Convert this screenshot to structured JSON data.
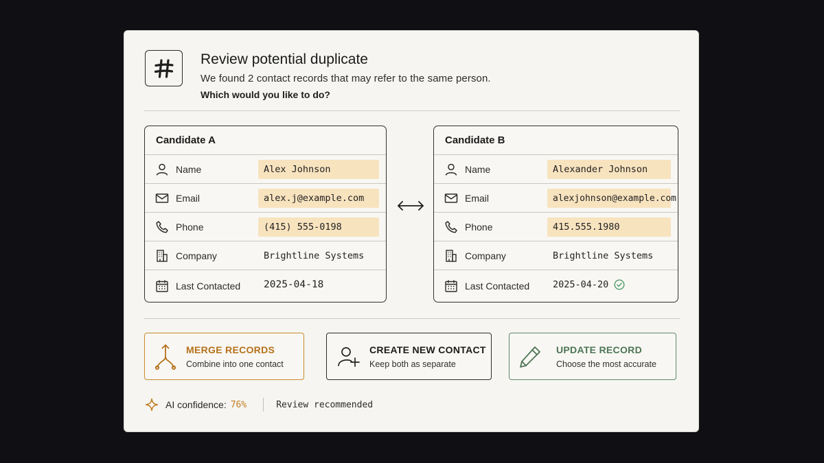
{
  "dialog": {
    "logo_icon": "hash-icon",
    "title": "Review potential duplicate",
    "subtitle": "We found 2 contact records that may refer to the same person.",
    "question": "Which would you like to do?"
  },
  "candidates": [
    {
      "title": "Candidate A",
      "fields": [
        {
          "icon": "user-icon",
          "label": "Name",
          "value": "Alex Johnson",
          "highlighted": true
        },
        {
          "icon": "mail-icon",
          "label": "Email",
          "value": "alex.j@example.com",
          "highlighted": true
        },
        {
          "icon": "phone-icon",
          "label": "Phone",
          "value": "(415) 555-0198",
          "highlighted": true
        },
        {
          "icon": "building-icon",
          "label": "Company",
          "value": "Brightline Systems",
          "highlighted": false
        },
        {
          "icon": "calendar-icon",
          "label": "Last Contacted",
          "value": "2025-04-18",
          "highlighted": false
        }
      ]
    },
    {
      "title": "Candidate B",
      "fields": [
        {
          "icon": "user-icon",
          "label": "Name",
          "value": "Alexander Johnson",
          "highlighted": true
        },
        {
          "icon": "mail-icon",
          "label": "Email",
          "value": "alexjohnson@example.com",
          "highlighted": true
        },
        {
          "icon": "phone-icon",
          "label": "Phone",
          "value": "415.555.1980",
          "highlighted": true
        },
        {
          "icon": "building-icon",
          "label": "Company",
          "value": "Brightline Systems",
          "highlighted": false
        },
        {
          "icon": "calendar-icon",
          "label": "Last Contacted",
          "value": "2025-04-20",
          "highlighted": false,
          "badge": "check-circle-icon"
        }
      ]
    }
  ],
  "actions": {
    "merge": {
      "label": "MERGE RECORDS",
      "sublabel": "Combine into one contact",
      "icon": "merge-icon",
      "color": "#b4711a"
    },
    "create": {
      "label": "CREATE NEW CONTACT",
      "sublabel": "Keep both as separate",
      "icon": "user-plus-icon",
      "color": "#1b1b1b"
    },
    "update": {
      "label": "UPDATE RECORD",
      "sublabel": "Choose the most accurate",
      "icon": "pencil-icon",
      "color": "#4d7556"
    }
  },
  "footer": {
    "confidence_label": "AI confidence:",
    "confidence_value": "76%",
    "recommendation": "Review recommended"
  },
  "colors": {
    "highlight": "#f8e3bf",
    "accent_orange": "#c98a2e",
    "accent_green": "#5f8a6b"
  }
}
